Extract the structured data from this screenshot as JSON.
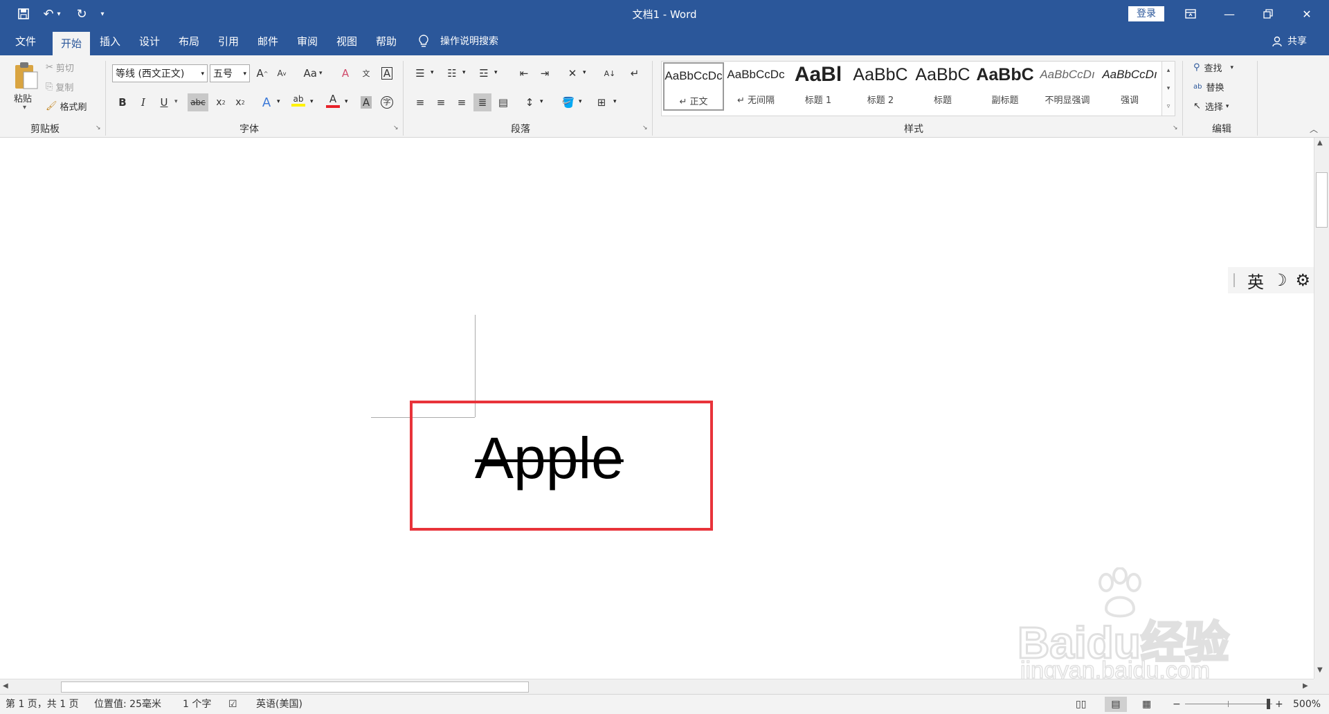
{
  "window": {
    "title": "文档1  -  Word",
    "login_label": "登录",
    "share_label": "共享"
  },
  "tabs": [
    "文件",
    "开始",
    "插入",
    "设计",
    "布局",
    "引用",
    "邮件",
    "审阅",
    "视图",
    "帮助"
  ],
  "active_tab": "开始",
  "tell_me": "操作说明搜索",
  "clipboard": {
    "paste": "粘贴",
    "cut": "剪切",
    "copy": "复制",
    "format_painter": "格式刷",
    "group_label": "剪贴板"
  },
  "font": {
    "name": "等线 (西文正文)",
    "size": "五号",
    "group_label": "字体"
  },
  "paragraph": {
    "group_label": "段落"
  },
  "styles": {
    "group_label": "样式",
    "items": [
      {
        "sample": "AaBbCcDc",
        "name": "↵ 正文"
      },
      {
        "sample": "AaBbCcDc",
        "name": "↵ 无间隔"
      },
      {
        "sample": "AaBl",
        "name": "标题 1"
      },
      {
        "sample": "AaBbC",
        "name": "标题 2"
      },
      {
        "sample": "AaBbC",
        "name": "标题"
      },
      {
        "sample": "AaBbC",
        "name": "副标题"
      },
      {
        "sample": "AaBbCcDı",
        "name": "不明显强调"
      },
      {
        "sample": "AaBbCcDı",
        "name": "强调"
      }
    ]
  },
  "editing": {
    "find": "查找",
    "replace": "替换",
    "select": "选择",
    "group_label": "编辑"
  },
  "document": {
    "text": "Apple"
  },
  "ime": {
    "lang": "英"
  },
  "watermark": {
    "brand": "Baidu经验",
    "url": "jingyan.baidu.com"
  },
  "status": {
    "page": "第 1 页，共 1 页",
    "position": "位置值: 25毫米",
    "words": "1 个字",
    "language": "英语(美国)",
    "zoom": "500%"
  },
  "colors": {
    "title_bar": "#2b579a",
    "highlight_box": "#e8333a",
    "font_color_bar": "#e8222a",
    "highlight_color_bar": "#fff200"
  }
}
